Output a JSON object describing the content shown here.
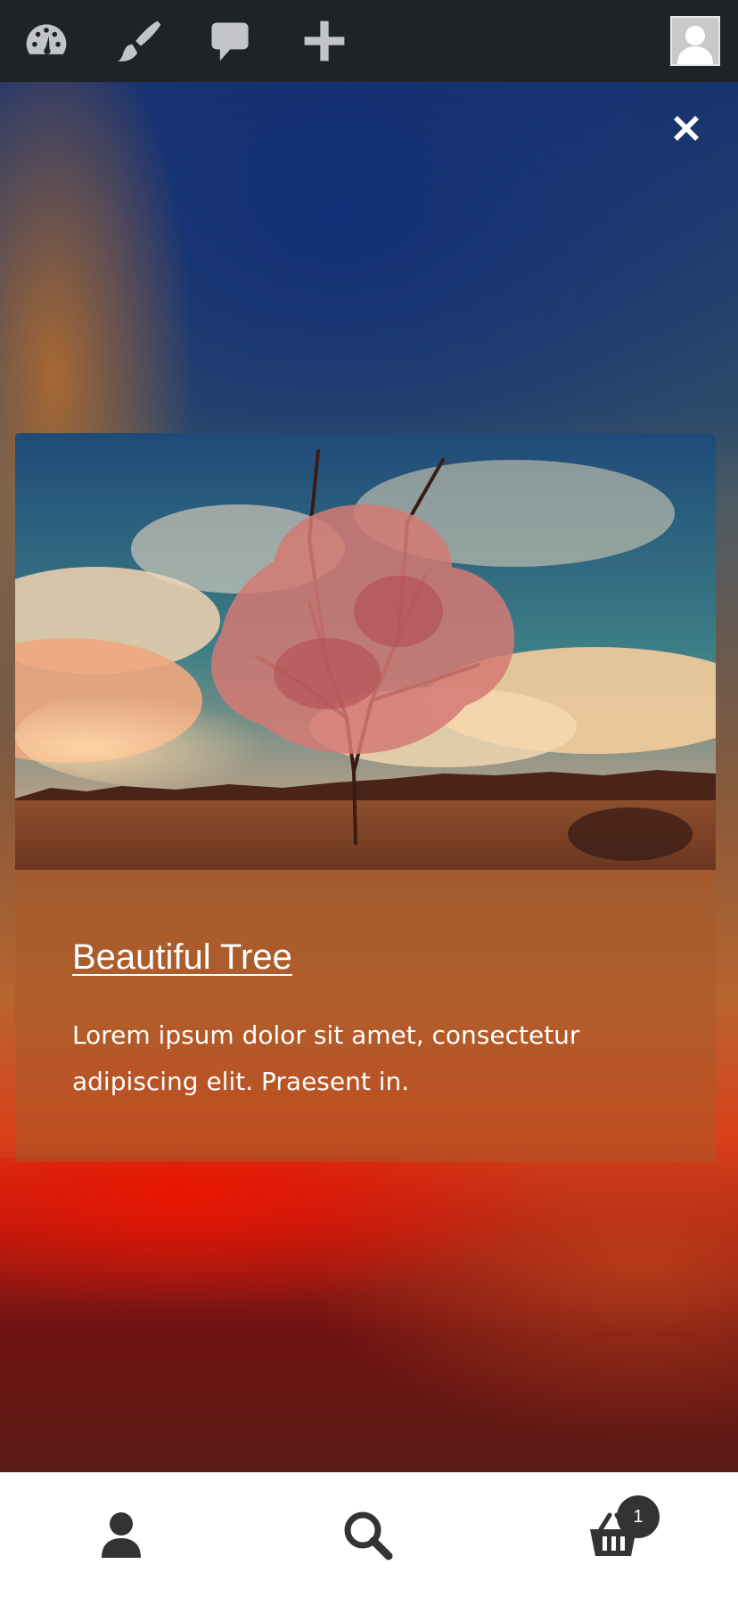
{
  "admin_bar": {
    "icons": [
      "dashboard-icon",
      "customize-brush-icon",
      "comments-icon",
      "new-content-plus-icon"
    ],
    "avatar": "user-avatar-icon"
  },
  "lightbox": {
    "close_icon": "close-icon"
  },
  "card": {
    "title": "Beautiful Tree",
    "description": "Lorem ipsum dolor sit amet, consectetur adipiscing elit. Praesent in.",
    "image_subject": "tree-landscape-image"
  },
  "bottom_nav": {
    "account_icon": "account-icon",
    "search_icon": "search-icon",
    "cart_icon": "cart-basket-icon",
    "cart_count": "1"
  },
  "colors": {
    "admin_bar_bg": "#1d2327",
    "admin_icon": "#c3c4c7",
    "bottom_nav_bg": "#ffffff",
    "bottom_icon": "#333333"
  }
}
